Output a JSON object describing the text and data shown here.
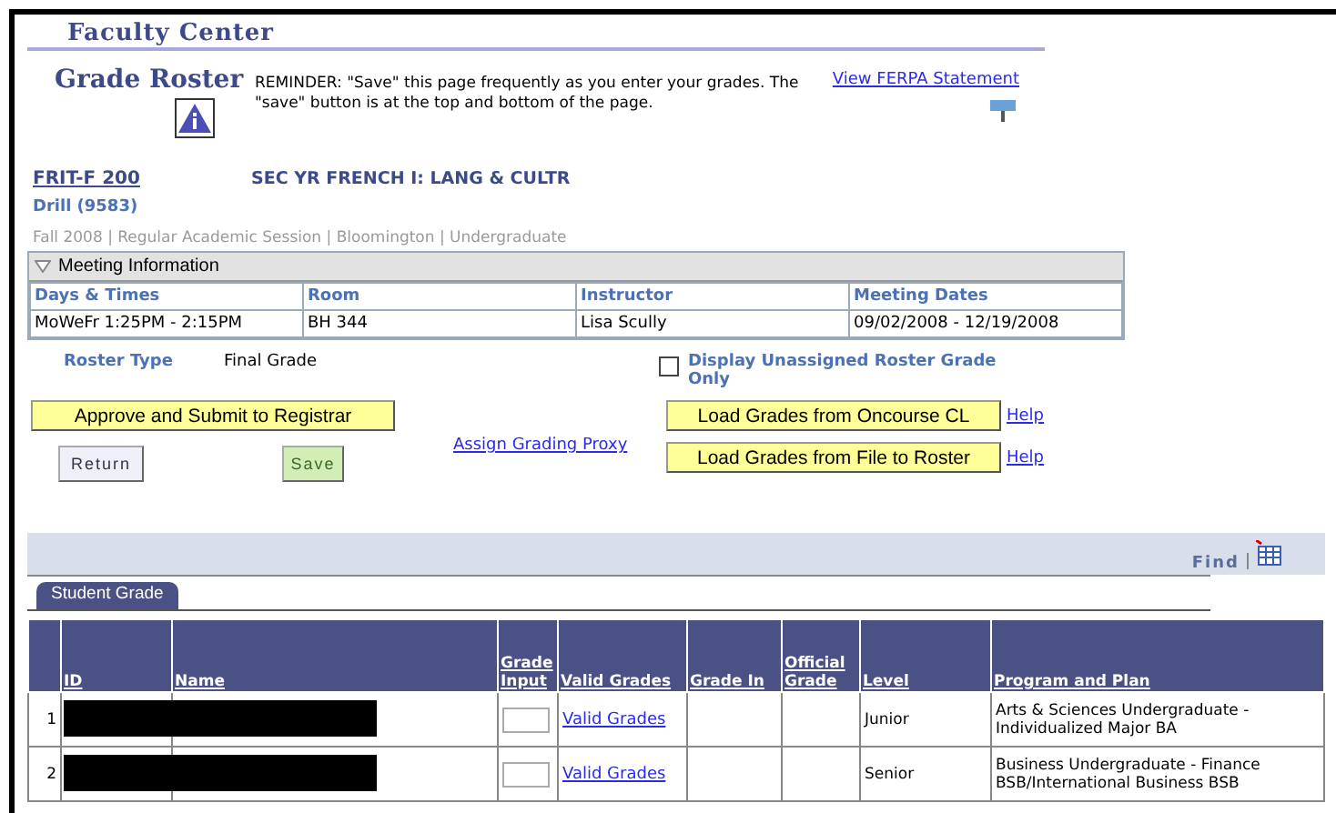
{
  "header": {
    "title": "Faculty Center"
  },
  "page": {
    "title": "Grade Roster",
    "reminder": "REMINDER:  \"Save\" this page frequently as you enter your grades.  The \"save\" button is at the top and bottom of the page.",
    "ferpa_link": "View FERPA Statement"
  },
  "course": {
    "code": "FRIT-F 200",
    "name": "SEC YR FRENCH I: LANG & CULTR",
    "section": "Drill  (9583)",
    "term": "Fall 2008 | Regular Academic Session | Bloomington | Undergraduate"
  },
  "meeting": {
    "title": "Meeting Information",
    "expanded": true,
    "columns": [
      "Days & Times",
      "Room",
      "Instructor",
      "Meeting Dates"
    ],
    "rows": [
      [
        "MoWeFr 1:25PM - 2:15PM",
        "BH 344",
        "Lisa Scully",
        "09/02/2008 - 12/19/2008"
      ]
    ]
  },
  "roster_type": {
    "label": "Roster Type",
    "value": "Final Grade"
  },
  "unassigned": {
    "label": "Display Unassigned Roster Grade Only",
    "checked": false
  },
  "buttons": {
    "approve": "Approve and Submit to Registrar",
    "proxy": "Assign Grading Proxy",
    "load": [
      {
        "label": "Load Grades from Oncourse CL",
        "help": "Help"
      },
      {
        "label": "Load Grades from File to Roster",
        "help": "Help"
      }
    ],
    "return": "Return",
    "save": "Save"
  },
  "grid": {
    "find": "Find",
    "tabs": [
      {
        "label": "Student Grade",
        "selected": true
      }
    ],
    "columns": [
      "",
      "ID",
      "Name",
      "Grade Input",
      "Valid Grades",
      "Grade In",
      "Official Grade",
      "Level",
      "Program and Plan"
    ],
    "rows": [
      {
        "num": "1",
        "redacted": true,
        "valid": "Valid Grades",
        "level": "Junior",
        "program": "Arts & Sciences Undergraduate - Individualized Major BA"
      },
      {
        "num": "2",
        "redacted": true,
        "valid": "Valid Grades",
        "level": "Senior",
        "program": "Business Undergraduate - Finance BSB/International Business BSB"
      }
    ]
  }
}
